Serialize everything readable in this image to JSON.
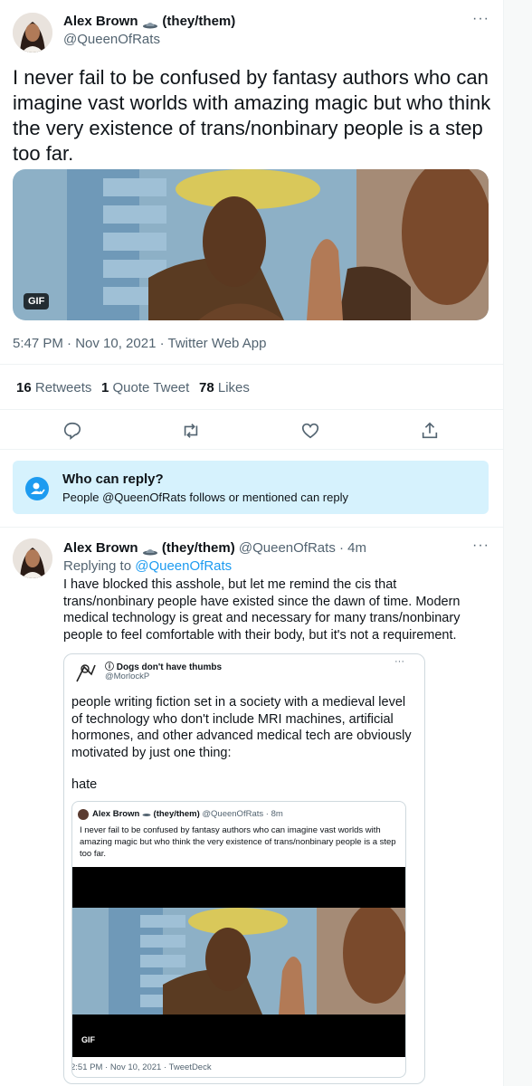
{
  "main_tweet": {
    "author_name": "Alex Brown",
    "pronouns": "(they/them)",
    "handle": "@QueenOfRats",
    "text": "I never fail to be confused by fantasy authors who can imagine vast worlds with amazing magic but who think the very existence of trans/nonbinary people is a step too far.",
    "gif_badge": "GIF",
    "timestamp": "5:47 PM · Nov 10, 2021 · Twitter Web App",
    "stats": {
      "retweets_count": "16",
      "retweets_label": "Retweets",
      "quotes_count": "1",
      "quotes_label": "Quote Tweet",
      "likes_count": "78",
      "likes_label": "Likes"
    },
    "reply_notice": {
      "title": "Who can reply?",
      "text": "People @QueenOfRats follows or mentioned can reply"
    }
  },
  "reply": {
    "author_name": "Alex Brown",
    "pronouns": "(they/them)",
    "handle": "@QueenOfRats",
    "time": "· 4m",
    "replying_to_label": "Replying to",
    "replying_to_handle": "@QueenOfRats",
    "text": "I have blocked this asshole, but let me remind the cis that trans/nonbinary people have existed since the dawn of time. Modern medical technology is great and necessary for many trans/nonbinary people to feel comfortable with their body, but it's not a requirement."
  },
  "quoted": {
    "author_name": "Dogs don't have thumbs",
    "name_prefix": "ⓘ",
    "handle": "@MorlockP",
    "text": "people writing fiction set in a society with a medieval level of technology who don't include MRI machines, artificial hormones, and other advanced medical tech are obviously motivated by just one thing:",
    "text2": "hate",
    "inner": {
      "author_name": "Alex Brown",
      "pronouns": "(they/them)",
      "handle": "@QueenOfRats",
      "time": "· 8m",
      "text": "I never fail to be confused by fantasy authors who can imagine vast worlds with amazing magic but who think the very existence of trans/nonbinary people is a step too far.",
      "gif_badge": "GIF",
      "timestamp": "2:51 PM · Nov 10, 2021 · TweetDeck"
    }
  },
  "icons": [
    "more-icon",
    "reply-icon",
    "retweet-icon",
    "like-icon",
    "share-icon",
    "mention-icon"
  ],
  "colors": {
    "accent": "#1d9bf0",
    "notice_bg": "#d6f2fd",
    "muted": "#536471"
  }
}
